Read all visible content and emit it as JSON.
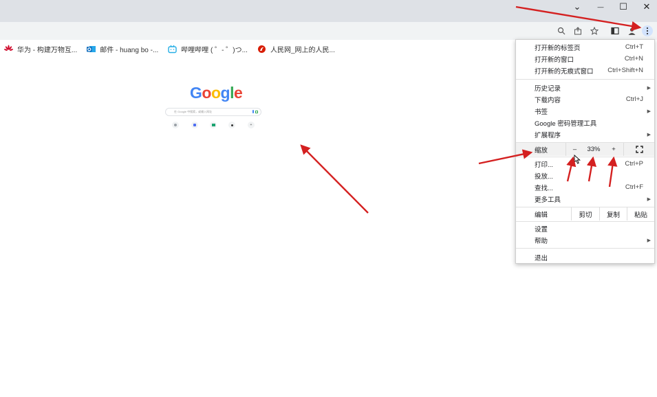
{
  "window": {
    "minimize_glyph": "—",
    "maximize_glyph": "☐",
    "close_glyph": "✕",
    "tabsearch_glyph": "⌄"
  },
  "bookmarks": [
    {
      "label": "华为 - 构建万物互...",
      "icon": "huawei-logo-icon",
      "color": "#cf0a2c"
    },
    {
      "label": "邮件 - huang bo -...",
      "icon": "outlook-mail-icon",
      "color": "#0f6cbd"
    },
    {
      "label": "哔哩哔哩 ( ゜- ゜)つ...",
      "icon": "bilibili-tv-icon",
      "color": "#23ade5"
    },
    {
      "label": "人民网_网上的人民...",
      "icon": "peoples-daily-logo-icon",
      "color": "#d81e06"
    }
  ],
  "newtab": {
    "logo_letters": [
      "G",
      "o",
      "o",
      "g",
      "l",
      "e"
    ],
    "logo_colors": [
      "#4285f4",
      "#ea4335",
      "#fbbc05",
      "#4285f4",
      "#34a853",
      "#ea4335"
    ],
    "search_placeholder": "在 Google 中搜索，或输入网址"
  },
  "menu": {
    "items_top": [
      {
        "label": "打开新的标签页",
        "shortcut": "Ctrl+T"
      },
      {
        "label": "打开新的窗口",
        "shortcut": "Ctrl+N"
      },
      {
        "label": "打开新的无痕式窗口",
        "shortcut": "Ctrl+Shift+N"
      }
    ],
    "items_mid": [
      {
        "label": "历史记录",
        "shortcut": "",
        "submenu": true
      },
      {
        "label": "下载内容",
        "shortcut": "Ctrl+J",
        "submenu": false
      },
      {
        "label": "书签",
        "shortcut": "",
        "submenu": true
      },
      {
        "label": "Google 密码管理工具",
        "shortcut": "",
        "submenu": false
      },
      {
        "label": "扩展程序",
        "shortcut": "",
        "submenu": true
      }
    ],
    "zoom": {
      "label": "缩放",
      "minus": "–",
      "value": "33%",
      "plus": "+"
    },
    "items_tools": [
      {
        "label": "打印...",
        "shortcut": "Ctrl+P",
        "submenu": false
      },
      {
        "label": "投放...",
        "shortcut": "",
        "submenu": false
      },
      {
        "label": "查找...",
        "shortcut": "Ctrl+F",
        "submenu": false
      },
      {
        "label": "更多工具",
        "shortcut": "",
        "submenu": true
      }
    ],
    "edit": {
      "label": "编辑",
      "cut": "剪切",
      "copy": "复制",
      "paste": "粘贴"
    },
    "items_bottom": [
      {
        "label": "设置",
        "submenu": false
      },
      {
        "label": "帮助",
        "submenu": true
      }
    ],
    "exit_label": "退出",
    "submenu_arrow": "▶"
  },
  "colors": {
    "annotation_arrow": "#d42020",
    "accent": "#1a73e8"
  }
}
